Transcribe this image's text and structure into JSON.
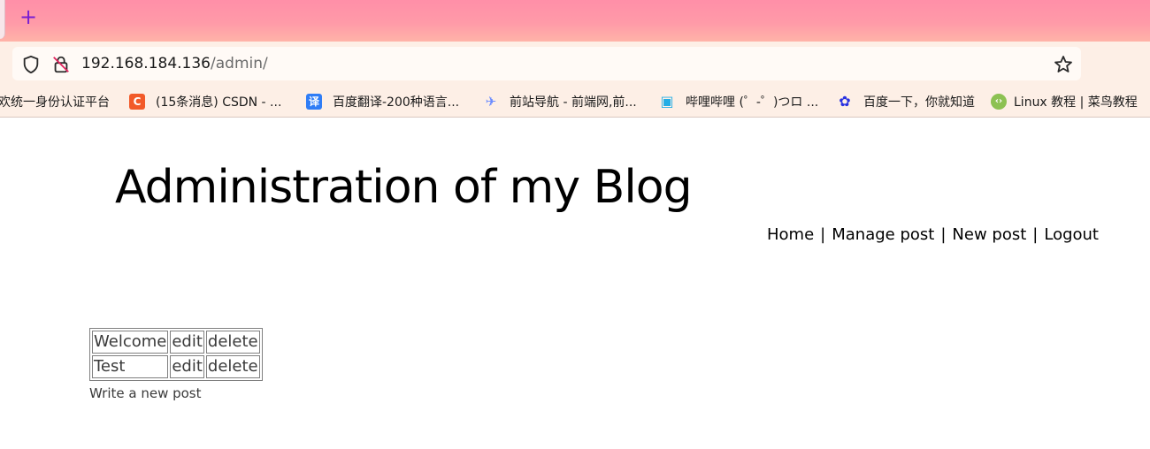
{
  "browser": {
    "new_tab_label": "+",
    "url_host": "192.168.184.136",
    "url_path": "/admin/"
  },
  "bookmarks": [
    {
      "label": "欢统一身份认证平台",
      "icon": "none",
      "color": ""
    },
    {
      "label": "(15条消息) CSDN - ...",
      "icon": "csdn-icon",
      "color": "#f25a29",
      "glyph": "C"
    },
    {
      "label": "百度翻译-200种语言...",
      "icon": "baidu-translate-icon",
      "color": "#2f7df6",
      "glyph": "译"
    },
    {
      "label": "前站导航 - 前端网,前...",
      "icon": "planet-icon",
      "color": "#6b8cff",
      "glyph": "✈"
    },
    {
      "label": "哔哩哔哩 (゜-゜)つロ ...",
      "icon": "bilibili-icon",
      "color": "#23ade5",
      "glyph": "▣"
    },
    {
      "label": "百度一下，你就知道",
      "icon": "baidu-paw-icon",
      "color": "#2932e1",
      "glyph": "✿"
    },
    {
      "label": "Linux 教程 | 菜鸟教程",
      "icon": "runoob-icon",
      "color": "#8cc152",
      "glyph": "‹›"
    }
  ],
  "page": {
    "title": "Administration of my Blog",
    "nav": {
      "home": "Home",
      "manage": "Manage post",
      "new": "New post",
      "logout": "Logout",
      "separator": "|"
    },
    "posts": [
      {
        "title": "Welcome",
        "edit": "edit",
        "delete": "delete"
      },
      {
        "title": "Test",
        "edit": "edit",
        "delete": "delete"
      }
    ],
    "write_new_link": "Write a new post"
  }
}
